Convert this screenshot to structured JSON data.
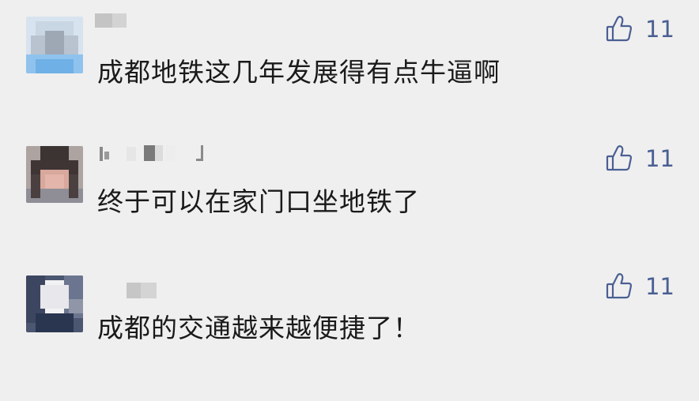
{
  "colors": {
    "background": "#efefef",
    "like_accent": "#4a5f93",
    "text": "#1a1a1a"
  },
  "comments": [
    {
      "name": "",
      "text": "成都地铁这几年发展得有点牛逼啊",
      "like_icon": "thumbs-up-icon",
      "likes": "11"
    },
    {
      "name": "",
      "text": "终于可以在家门口坐地铁了",
      "like_icon": "thumbs-up-icon",
      "likes": "11"
    },
    {
      "name": "",
      "text": "成都的交通越来越便捷了！",
      "like_icon": "thumbs-up-icon",
      "likes": "11"
    }
  ]
}
